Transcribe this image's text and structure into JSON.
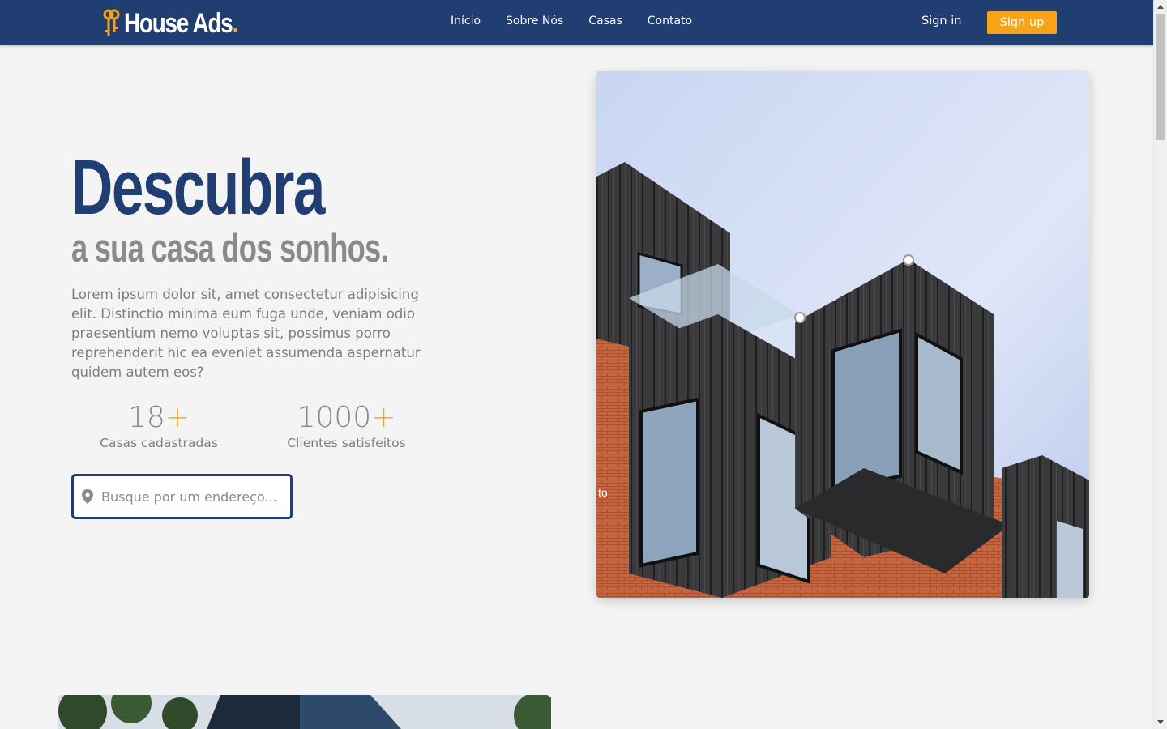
{
  "header": {
    "logo_text": "House Ads",
    "logo_dot": ".",
    "nav": [
      "Início",
      "Sobre Nós",
      "Casas",
      "Contato"
    ],
    "sign_in": "Sign in",
    "sign_up": "Sign up"
  },
  "hero": {
    "title": "Descubra",
    "subtitle": "a sua casa dos sonhos.",
    "text": "Lorem ipsum dolor sit, amet consectetur adipisicing elit. Distinctio minima eum fuga unde, veniam odio praesentium nemo voluptas sit, possimus porro reprehenderit hic ea eveniet assumenda aspernatur quidem autem eos?",
    "stats": [
      {
        "value": "18",
        "plus": "+",
        "label": "Casas cadastradas"
      },
      {
        "value": "1000",
        "plus": "+",
        "label": "Clientes satisfeitos"
      }
    ],
    "search_placeholder": "Busque por um endereço...",
    "image_caption": "to"
  },
  "colors": {
    "brand_blue": "#203e72",
    "accent_orange": "#f5a416",
    "text_gray": "#7e7e7e",
    "background": "#f4f4f4"
  },
  "icons": {
    "logo": "keys-icon",
    "search": "map-pin-icon"
  }
}
